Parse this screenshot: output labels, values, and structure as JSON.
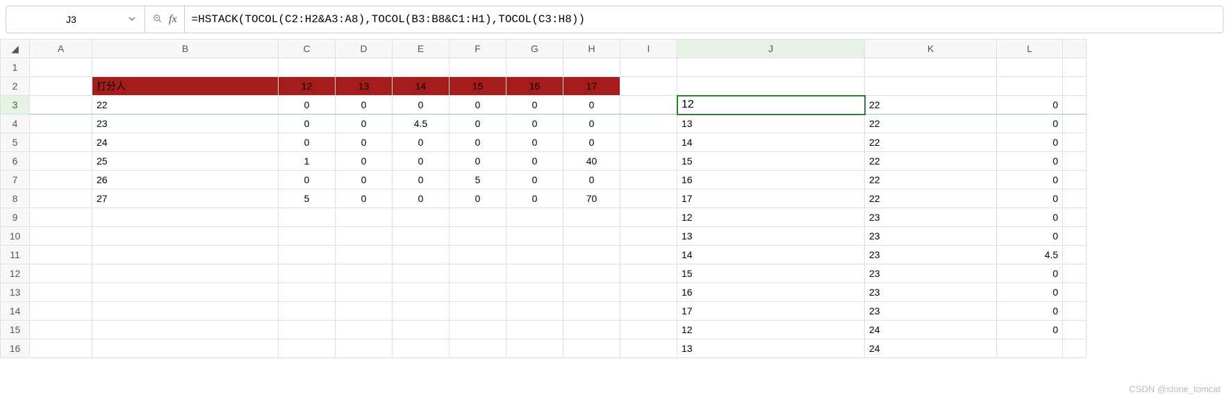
{
  "namebox": {
    "value": "J3"
  },
  "fx": {
    "label": "fx"
  },
  "formula": "=HSTACK(TOCOL(C2:H2&A3:A8),TOCOL(B3:B8&C1:H1),TOCOL(C3:H8))",
  "cols": {
    "A": "A",
    "B": "B",
    "C": "C",
    "D": "D",
    "E": "E",
    "F": "F",
    "G": "G",
    "H": "H",
    "I": "I",
    "J": "J",
    "K": "K",
    "L": "L"
  },
  "rows": [
    "1",
    "2",
    "3",
    "4",
    "5",
    "6",
    "7",
    "8",
    "9",
    "10",
    "11",
    "12",
    "13",
    "14",
    "15",
    "16"
  ],
  "table_left": {
    "header_label": "打分人",
    "header_cols": [
      "12",
      "13",
      "14",
      "15",
      "16",
      "17"
    ],
    "row_labels": [
      "22",
      "23",
      "24",
      "25",
      "26",
      "27"
    ],
    "data": [
      [
        "0",
        "0",
        "0",
        "0",
        "0",
        "0"
      ],
      [
        "0",
        "0",
        "4.5",
        "0",
        "0",
        "0"
      ],
      [
        "0",
        "0",
        "0",
        "0",
        "0",
        "0"
      ],
      [
        "1",
        "0",
        "0",
        "0",
        "0",
        "40"
      ],
      [
        "0",
        "0",
        "0",
        "5",
        "0",
        "0"
      ],
      [
        "5",
        "0",
        "0",
        "0",
        "0",
        "70"
      ]
    ]
  },
  "spill": {
    "rows": [
      [
        "12",
        "22",
        "0"
      ],
      [
        "13",
        "22",
        "0"
      ],
      [
        "14",
        "22",
        "0"
      ],
      [
        "15",
        "22",
        "0"
      ],
      [
        "16",
        "22",
        "0"
      ],
      [
        "17",
        "22",
        "0"
      ],
      [
        "12",
        "23",
        "0"
      ],
      [
        "13",
        "23",
        "0"
      ],
      [
        "14",
        "23",
        "4.5"
      ],
      [
        "15",
        "23",
        "0"
      ],
      [
        "16",
        "23",
        "0"
      ],
      [
        "17",
        "23",
        "0"
      ],
      [
        "12",
        "24",
        "0"
      ],
      [
        "13",
        "24",
        ""
      ]
    ]
  },
  "watermark": "CSDN @stone_tomcat"
}
